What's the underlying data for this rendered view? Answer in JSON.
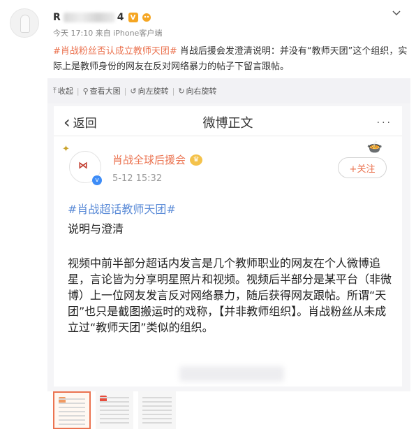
{
  "post": {
    "name_prefix": "R",
    "name_suffix": "4",
    "verified_badge": "V",
    "meta": "今天 17:10 来自 iPhone客户端",
    "topic": "#肖战粉丝否认成立教师天团#",
    "text": " 肖战后援会发澄清说明：并没有“教师天团”这个组织，实际上是教师身份的网友在反对网络暴力的帖子下留言跟帖。"
  },
  "toolbar": {
    "collapse": "收起",
    "view_large": "查看大图",
    "rotate_left": "向左旋转",
    "rotate_right": "向右旋转"
  },
  "screenshot": {
    "back": "返回",
    "nav_title": "微博正文",
    "more": "···",
    "author": "肖战全球后援会",
    "time": "5-12 15:32",
    "follow": "+关注",
    "topic": "#肖战超话教师天团#",
    "subtitle": "说明与澄清",
    "body": "视频中前半部分超话内发言是几个教师职业的网友在个人微博追星，言论皆为分享明星照片和视频。视频后半部分是某平台（非微博）上一位网友发言反对网络暴力，随后获得网友跟帖。所谓“天团”也只是截图搬运时的戏称，【并非教师组织】。肖战粉丝从未成立过“教师天团”类似的组织。"
  },
  "icons": {
    "chevron": "chevron-down-icon",
    "collapse": "arrow-up-icon",
    "view": "magnify-icon",
    "rotate_left": "rotate-left-icon",
    "rotate_right": "rotate-right-icon"
  },
  "colors": {
    "accent": "#eb7350",
    "topic_blue": "#5b8bd7",
    "badge": "#f5a623"
  }
}
